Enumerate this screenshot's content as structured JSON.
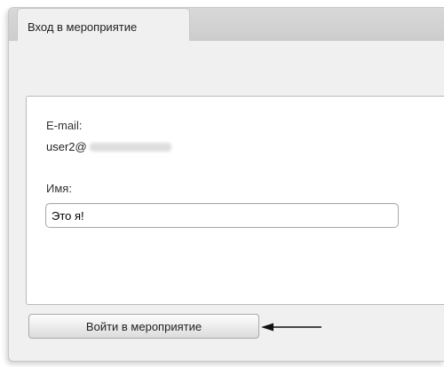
{
  "tab": {
    "title": "Вход в мероприятие"
  },
  "form": {
    "email_label": "E-mail:",
    "email_value": "user2@",
    "name_label": "Имя:",
    "name_value": "Это я!"
  },
  "actions": {
    "join_label": "Войти в мероприятие"
  },
  "icons": {
    "pointer_arrow": "arrow-left-icon"
  },
  "colors": {
    "window_bg": "#f0f0f0",
    "tabstrip_bg": "#d3d3d3",
    "panel_bg": "#ffffff",
    "border": "#c7c7c7"
  }
}
